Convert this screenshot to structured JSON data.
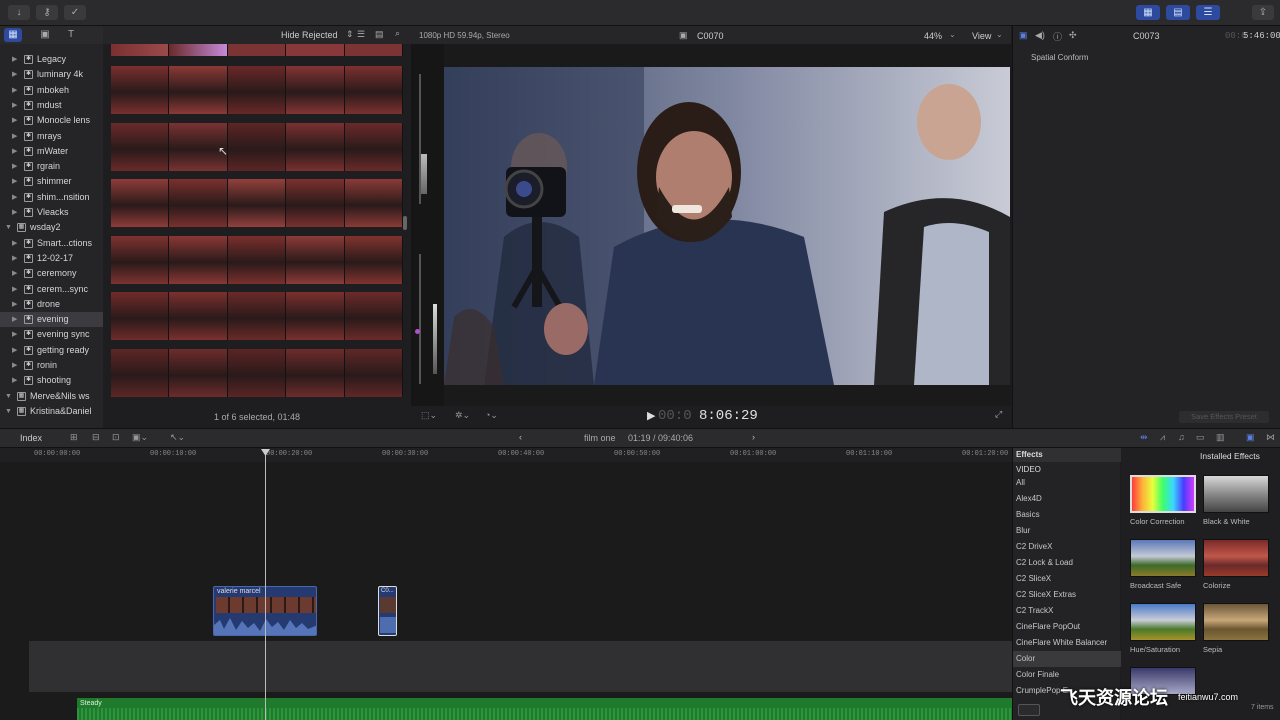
{
  "libraries": {
    "items": [
      {
        "label": "Legacy",
        "level": 1
      },
      {
        "label": "luminary 4k",
        "level": 1
      },
      {
        "label": "mbokeh",
        "level": 1
      },
      {
        "label": "mdust",
        "level": 1
      },
      {
        "label": "Monocle lens",
        "level": 1
      },
      {
        "label": "mrays",
        "level": 1
      },
      {
        "label": "mWater",
        "level": 1
      },
      {
        "label": "rgrain",
        "level": 1
      },
      {
        "label": "shimmer",
        "level": 1
      },
      {
        "label": "shim...nsition",
        "level": 1
      },
      {
        "label": "Vleacks",
        "level": 1
      },
      {
        "label": "wsday2",
        "level": 0
      },
      {
        "label": "Smart...ctions",
        "level": 1
      },
      {
        "label": "12-02-17",
        "level": 1
      },
      {
        "label": "ceremony",
        "level": 1
      },
      {
        "label": "cerem...sync",
        "level": 1
      },
      {
        "label": "drone",
        "level": 1
      },
      {
        "label": "evening",
        "level": 1,
        "selected": true
      },
      {
        "label": "evening sync",
        "level": 1
      },
      {
        "label": "getting ready",
        "level": 1
      },
      {
        "label": "ronin",
        "level": 1
      },
      {
        "label": "shooting",
        "level": 1
      },
      {
        "label": "Merve&Nils ws",
        "level": 0
      },
      {
        "label": "Kristina&Daniel",
        "level": 0
      }
    ]
  },
  "browser": {
    "filter": "Hide Rejected",
    "status": "1 of 6 selected, 01:48"
  },
  "viewer": {
    "format": "1080p HD 59.94p, Stereo",
    "clip_name": "C0070",
    "zoom": "44%",
    "view_label": "View",
    "timecode_dim": "00:0",
    "timecode": "8:06:29"
  },
  "inspector": {
    "clip_name": "C0073",
    "timecode_dim": "00:0",
    "timecode": "5:46:00",
    "section": "Spatial Conform",
    "save_preset": "Save Effects Preset"
  },
  "timeline": {
    "index_label": "Index",
    "project": "film one",
    "position": "01:19 / 09:40:06",
    "ruler": [
      "00:00:00:00",
      "00:00:10:00",
      "00:00:20:00",
      "00:00:30:00",
      "00:00:40:00",
      "00:00:50:00",
      "00:01:00:00",
      "00:01:10:00",
      "00:01:20:00"
    ],
    "clip1": "valerie marcel",
    "clip2": "C0...",
    "music": "Steady"
  },
  "effects": {
    "header": "Effects",
    "installed": "Installed Effects",
    "section": "VIDEO",
    "categories": [
      "All",
      "Alex4D",
      "Basics",
      "Blur",
      "C2 DriveX",
      "C2 Lock & Load",
      "C2 SliceX",
      "C2 SliceX Extras",
      "C2 TrackX",
      "CineFlare PopOut",
      "CineFlare White Balancer",
      "Color",
      "Color Finale",
      "CrumplePop E..."
    ],
    "thumbs": [
      "Color Correction",
      "Black & White",
      "Broadcast Safe",
      "Colorize",
      "Hue/Saturation",
      "Sepia"
    ],
    "count": "7 items"
  },
  "watermark": {
    "text": "飞天资源论坛",
    "url": "feitianwu7.com"
  },
  "colors": {
    "accent": "#2d4a9e",
    "selection": "#3c3c40",
    "music": "#1f7a2e"
  }
}
